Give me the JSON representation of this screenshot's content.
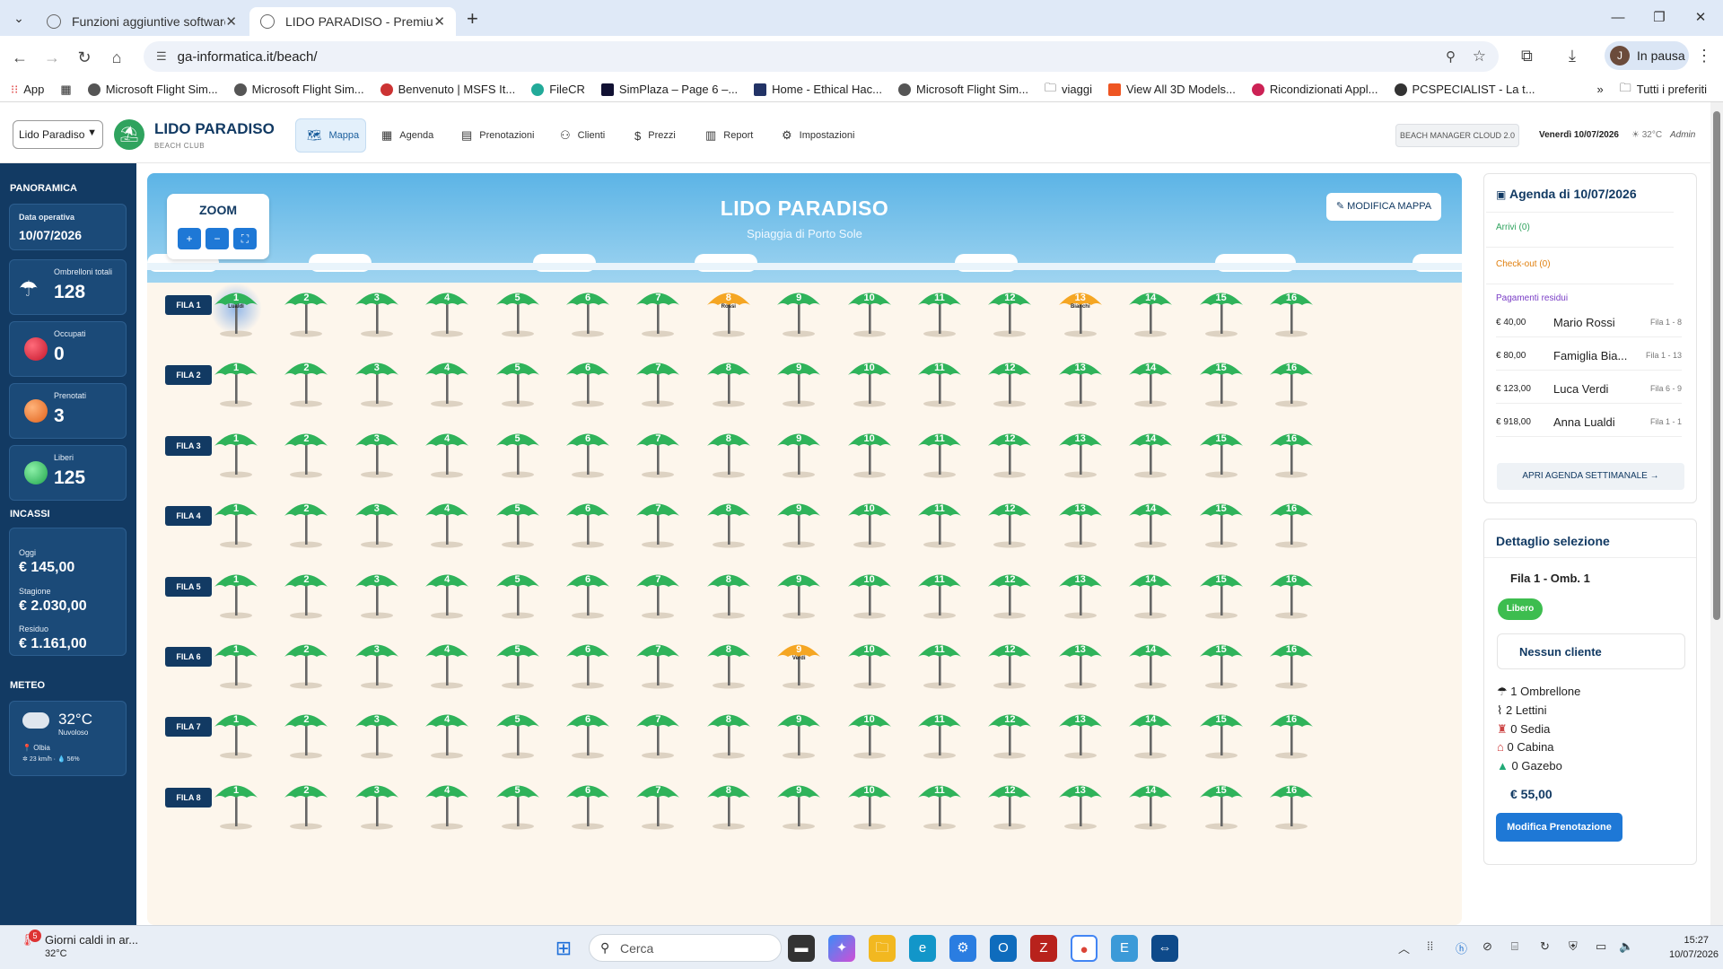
{
  "browser": {
    "tabs": [
      {
        "label": "Funzioni aggiuntive software"
      },
      {
        "label": "LIDO PARADISO - Premium"
      }
    ],
    "url": "ga-informatica.it/beach/",
    "profile": "In pausa",
    "profile_initial": "J",
    "bookmarks": [
      "App",
      "Microsoft Flight Sim...",
      "Microsoft Flight Sim...",
      "Benvenuto | MSFS It...",
      "FileCR",
      "SimPlaza – Page 6 –...",
      "Home - Ethical Hac...",
      "Microsoft Flight Sim...",
      "viaggi",
      "View All 3D Models...",
      "Ricondizionati Appl...",
      "PCSPECIALIST - La t..."
    ],
    "bookmarks_all": "Tutti i preferiti"
  },
  "header": {
    "location_select": "Lido Paradiso",
    "brand": "LIDO PARADISO",
    "brand_sub": "BEACH CLUB",
    "nav": [
      {
        "label": "Mappa",
        "icon": "map-icon"
      },
      {
        "label": "Agenda",
        "icon": "calendar-icon"
      },
      {
        "label": "Prenotazioni",
        "icon": "clipboard-icon"
      },
      {
        "label": "Clienti",
        "icon": "user-icon"
      },
      {
        "label": "Prezzi",
        "icon": "dollar-icon"
      },
      {
        "label": "Report",
        "icon": "chart-icon"
      },
      {
        "label": "Impostazioni",
        "icon": "gear-icon"
      }
    ],
    "cloud_badge": "BEACH MANAGER CLOUD 2.0",
    "date": "Venerdì 10/07/2026",
    "temp": "32°C",
    "user": "Admin"
  },
  "sidebar": {
    "panoramica_title": "PANORAMICA",
    "data_operativa_label": "Data operativa",
    "data_operativa": "10/07/2026",
    "ombrelloni_label": "Ombrelloni totali",
    "ombrelloni": "128",
    "occupati_label": "Occupati",
    "occupati": "0",
    "prenotati_label": "Prenotati",
    "prenotati": "3",
    "liberi_label": "Liberi",
    "liberi": "125",
    "incassi_title": "INCASSI",
    "oggi_label": "Oggi",
    "oggi": "€ 145,00",
    "stagione_label": "Stagione",
    "stagione": "€ 2.030,00",
    "residuo_label": "Residuo",
    "residuo": "€ 1.161,00",
    "meteo_title": "METEO",
    "meteo_temp": "32°C",
    "meteo_desc": "Nuvoloso",
    "meteo_loc": "Olbia",
    "meteo_wind": "23 km/h",
    "meteo_hum": "56%",
    "colors": {
      "occupati": "#e8344a",
      "prenotati": "#f7893a",
      "liberi": "#3dcc6a"
    }
  },
  "map": {
    "title": "LIDO PARADISO",
    "subtitle": "Spiaggia di Porto Sole",
    "zoom_label": "ZOOM",
    "zoom_buttons": [
      "+",
      "−",
      "⛶"
    ],
    "edit_button": "✎ MODIFICA MAPPA",
    "rows": [
      "FILA 1",
      "FILA 2",
      "FILA 3",
      "FILA 4",
      "FILA 5",
      "FILA 6",
      "FILA 7",
      "FILA 8"
    ],
    "umbrellas_per_row": 16,
    "colors": {
      "free": "#2fb35a",
      "booked": "#f5a623"
    },
    "booked": [
      {
        "row": 1,
        "num": 8,
        "name": "Rossi"
      },
      {
        "row": 1,
        "num": 13,
        "name": "Bianchi"
      },
      {
        "row": 6,
        "num": 9,
        "name": "Verdi"
      }
    ],
    "selected": {
      "row": 1,
      "num": 1,
      "name": "Lualdi"
    }
  },
  "agenda": {
    "title": "Agenda di 10/07/2026",
    "arrivi": "Arrivi (0)",
    "checkout": "Check-out (0)",
    "pagamenti": "Pagamenti residui",
    "payments": [
      {
        "amount": "€ 40,00",
        "client": "Mario Rossi",
        "pos": "Fila 1 - 8"
      },
      {
        "amount": "€ 80,00",
        "client": "Famiglia Bia...",
        "pos": "Fila 1 - 13"
      },
      {
        "amount": "€ 123,00",
        "client": "Luca Verdi",
        "pos": "Fila 6 - 9"
      },
      {
        "amount": "€ 918,00",
        "client": "Anna Lualdi",
        "pos": "Fila 1 - 1"
      }
    ],
    "button": "APRI AGENDA SETTIMANALE →"
  },
  "detail": {
    "title": "Dettaglio selezione",
    "subtitle": "Fila 1 - Omb. 1",
    "badge": "Libero",
    "client": "Nessun cliente",
    "items": [
      "1 Ombrellone",
      "2 Lettini",
      "0 Sedia",
      "0 Cabina",
      "0 Gazebo"
    ],
    "price": "€ 55,00",
    "button": "Modifica Prenotazione"
  },
  "taskbar": {
    "weather": "Giorni caldi in ar...",
    "weather_temp": "32°C",
    "weather_badge": "5",
    "search": "Cerca",
    "time": "15:27",
    "date": "10/07/2026"
  }
}
